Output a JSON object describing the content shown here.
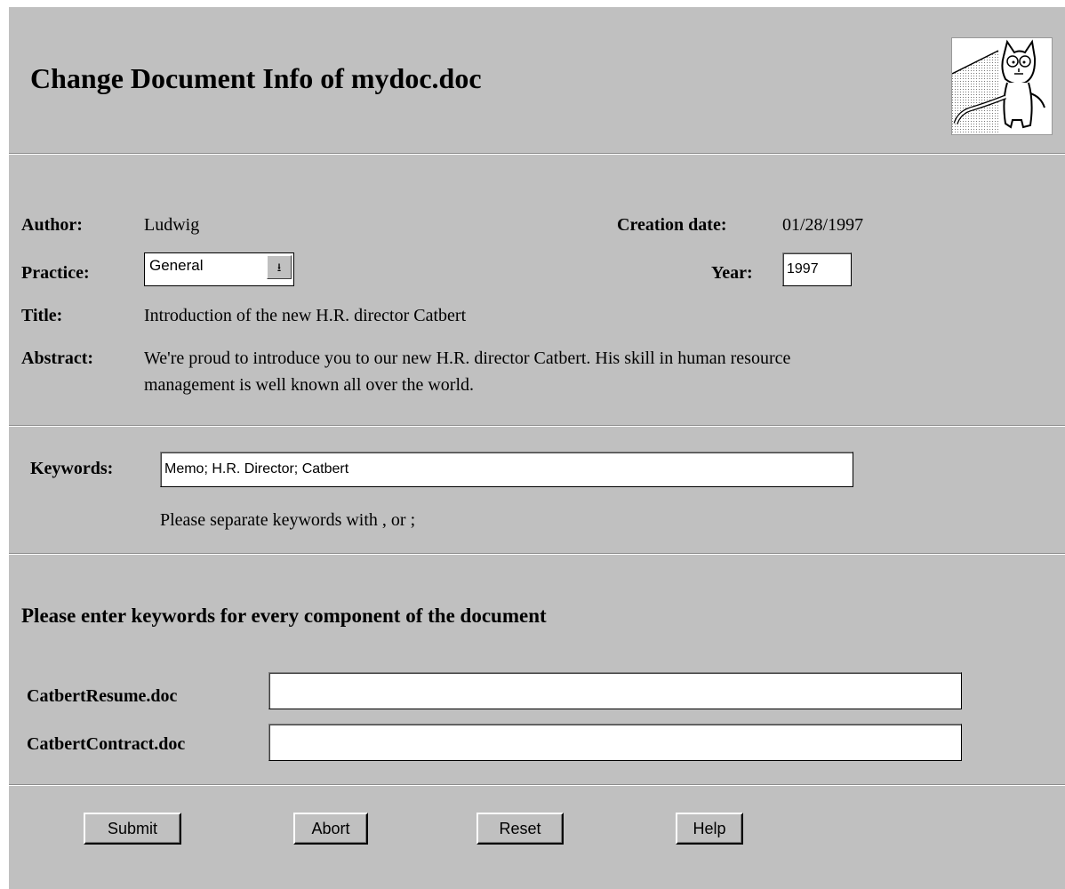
{
  "header": {
    "title": "Change Document Info of mydoc.doc",
    "logo_icon": "catbert-cartoon-icon"
  },
  "info": {
    "author_label": "Author:",
    "author_value": "Ludwig",
    "creation_date_label": "Creation date:",
    "creation_date_value": "01/28/1997",
    "practice_label": "Practice:",
    "practice_value": "General",
    "year_label": "Year:",
    "year_value": "1997",
    "title_label": "Title:",
    "title_value": "Introduction of the new H.R. director Catbert",
    "abstract_label": "Abstract:",
    "abstract_line1": "We're proud to introduce you to our new H.R. director Catbert. His skill in human resource",
    "abstract_line2": "management is well known all over the world."
  },
  "keywords": {
    "label": "Keywords:",
    "value": "Memo; H.R. Director; Catbert",
    "hint": "Please separate keywords with , or ;"
  },
  "components": {
    "heading": "Please enter keywords for every component of the document",
    "items": [
      {
        "name": "CatbertResume.doc",
        "value": ""
      },
      {
        "name": "CatbertContract.doc",
        "value": ""
      }
    ]
  },
  "buttons": {
    "submit": "Submit",
    "abort": "Abort",
    "reset": "Reset",
    "help": "Help"
  }
}
